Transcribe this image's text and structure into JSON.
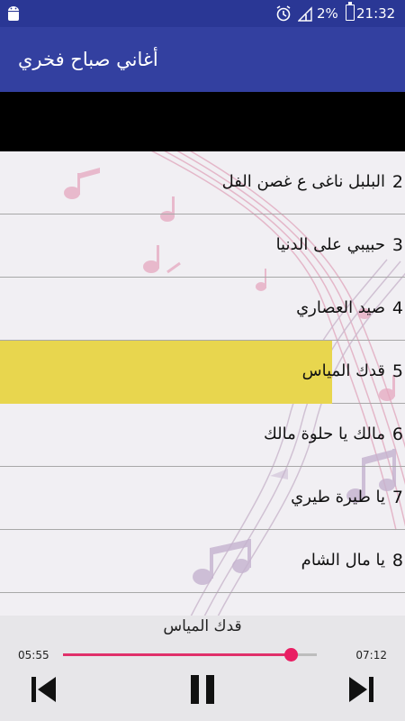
{
  "status_bar": {
    "android_icon": "android-icon",
    "alarm_icon": "alarm-icon",
    "signal_icon": "signal-icon",
    "battery_text": "2%",
    "time": "21:32"
  },
  "app_bar": {
    "title": "أغاني صباح فخري"
  },
  "tracks": [
    {
      "number": "2",
      "title": "البلبل ناغى ع غصن الفل",
      "selected": false
    },
    {
      "number": "3",
      "title": "حبيبي على الدنيا",
      "selected": false
    },
    {
      "number": "4",
      "title": "صيد العصاري",
      "selected": false
    },
    {
      "number": "5",
      "title": "قدك المياس",
      "selected": true
    },
    {
      "number": "6",
      "title": "مالك يا حلوة مالك",
      "selected": false
    },
    {
      "number": "7",
      "title": "يا طيرة طيري",
      "selected": false
    },
    {
      "number": "8",
      "title": "يا مال الشام",
      "selected": false
    }
  ],
  "player": {
    "now_playing": "قدك المياس",
    "elapsed": "05:55",
    "total": "07:12",
    "progress": 0.897,
    "prev_icon": "skip-previous-icon",
    "pause_icon": "pause-icon",
    "next_icon": "skip-next-icon"
  },
  "colors": {
    "status_bar": "#2a3795",
    "app_bar": "#3340a0",
    "highlight": "#e8d64e",
    "accent": "#e91e63"
  }
}
